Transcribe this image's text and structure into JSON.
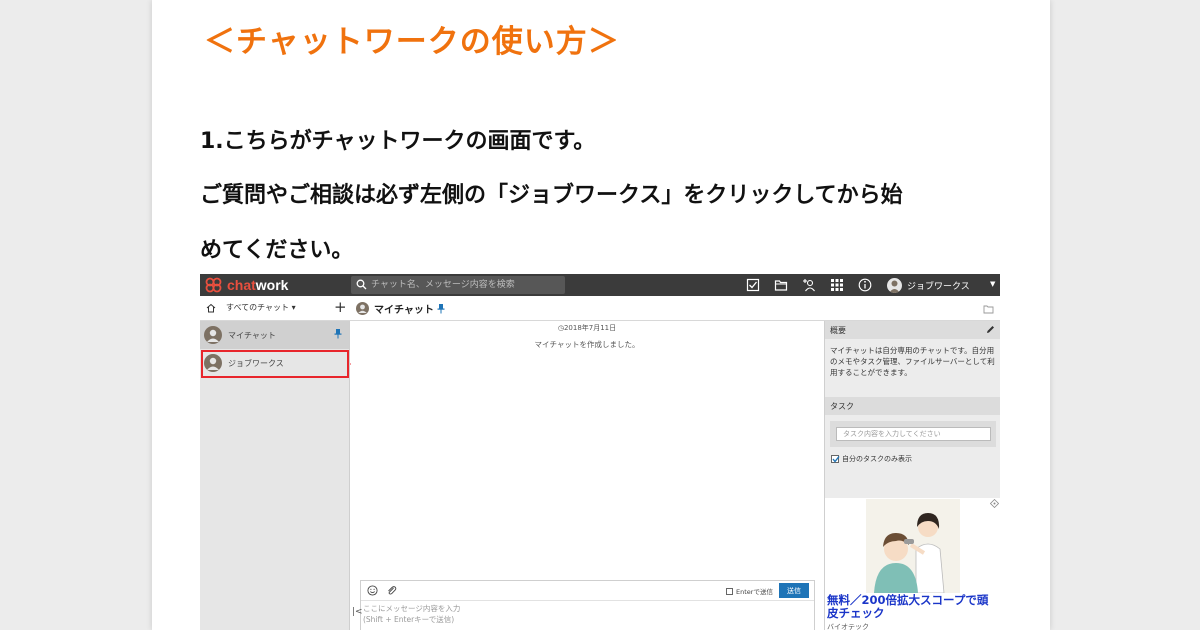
{
  "heading": "＜チャットワークの使い方＞",
  "paragraphs": [
    "1.こちらがチャットワークの画面です。",
    "ご質問やご相談は必ず左側の「ジョブワークス」をクリックしてから始",
    "めてください。"
  ],
  "screenshot": {
    "logo": {
      "part1": "chat",
      "part2": "work"
    },
    "search_placeholder": "チャット名、メッセージ内容を検索",
    "user_name": "ジョブワークス",
    "all_chats_label": "すべてのチャット ▾",
    "room_title": "マイチャット",
    "rooms": [
      {
        "name": "マイチャット"
      },
      {
        "name": "ジョブワークス"
      }
    ],
    "timeline": {
      "date": "2018年7月11日",
      "system_message": "マイチャットを作成しました。"
    },
    "chat_input": {
      "enter_label": "Enterで送信",
      "send_label": "送信",
      "placeholder_line1": "ここにメッセージ内容を入力",
      "placeholder_line2": "(Shift + Enterキーで送信)"
    },
    "right_panel": {
      "summary_heading": "概要",
      "summary_text": "マイチャットは自分専用のチャットです。自分用のメモやタスク管理、ファイルサーバーとして利用することができます。",
      "task_heading": "タスク",
      "task_placeholder": "タスク内容を入力してください",
      "own_tasks_label": "自分のタスクのみ表示",
      "ad_title": "無料／200倍拡大スコープで頭皮チェック",
      "ad_source": "バイオテック"
    }
  },
  "colors": {
    "heading": "#f0720e",
    "highlight": "#e8262c",
    "ad_link": "#1a35c8",
    "topbar": "#3b3b3b",
    "send_button": "#1e74b7"
  }
}
